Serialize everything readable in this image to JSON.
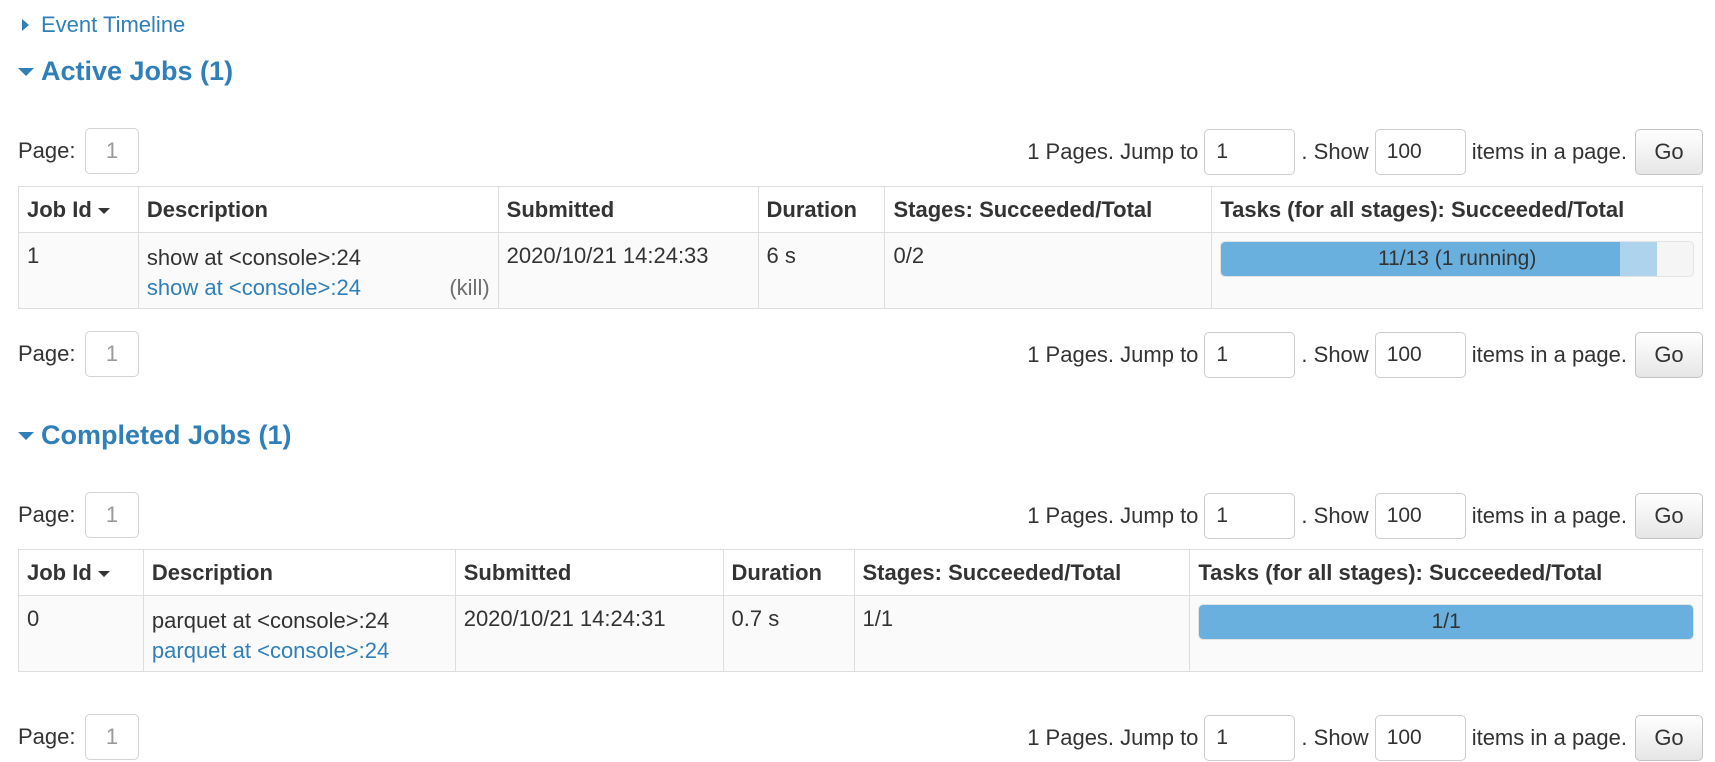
{
  "event_timeline": {
    "label": "Event Timeline"
  },
  "active_jobs": {
    "title": "Active Jobs (1)",
    "pager_top": {
      "page_label": "Page:",
      "page_value": "1",
      "pages_text": "1 Pages. Jump to",
      "jump_value": "1",
      "show_text": ". Show",
      "show_value": "100",
      "items_text": "items in a page.",
      "go_label": "Go"
    },
    "pager_bottom": {
      "page_label": "Page:",
      "page_value": "1",
      "pages_text": "1 Pages. Jump to",
      "jump_value": "1",
      "show_text": ". Show",
      "show_value": "100",
      "items_text": "items in a page.",
      "go_label": "Go"
    },
    "columns": [
      "Job Id",
      "Description",
      "Submitted",
      "Duration",
      "Stages: Succeeded/Total",
      "Tasks (for all stages): Succeeded/Total"
    ],
    "rows": [
      {
        "job_id": "1",
        "description": "show at <console>:24",
        "description_link": "show at <console>:24",
        "kill": "(kill)",
        "submitted": "2020/10/21 14:24:33",
        "duration": "6 s",
        "stages": "0/2",
        "tasks_label": "11/13 (1 running)",
        "tasks_succeeded": 11,
        "tasks_running": 1,
        "tasks_total": 13
      }
    ]
  },
  "completed_jobs": {
    "title": "Completed Jobs (1)",
    "pager_top": {
      "page_label": "Page:",
      "page_value": "1",
      "pages_text": "1 Pages. Jump to",
      "jump_value": "1",
      "show_text": ". Show",
      "show_value": "100",
      "items_text": "items in a page.",
      "go_label": "Go"
    },
    "pager_bottom": {
      "page_label": "Page:",
      "page_value": "1",
      "pages_text": "1 Pages. Jump to",
      "jump_value": "1",
      "show_text": ". Show",
      "show_value": "100",
      "items_text": "items in a page.",
      "go_label": "Go"
    },
    "columns": [
      "Job Id",
      "Description",
      "Submitted",
      "Duration",
      "Stages: Succeeded/Total",
      "Tasks (for all stages): Succeeded/Total"
    ],
    "rows": [
      {
        "job_id": "0",
        "description": "parquet at <console>:24",
        "description_link": "parquet at <console>:24",
        "submitted": "2020/10/21 14:24:31",
        "duration": "0.7 s",
        "stages": "1/1",
        "tasks_label": "1/1",
        "tasks_succeeded": 1,
        "tasks_running": 0,
        "tasks_total": 1
      }
    ]
  },
  "colors": {
    "link": "#2f7fb9",
    "progress_done": "#6ab0de",
    "progress_running": "#aed3ec"
  }
}
